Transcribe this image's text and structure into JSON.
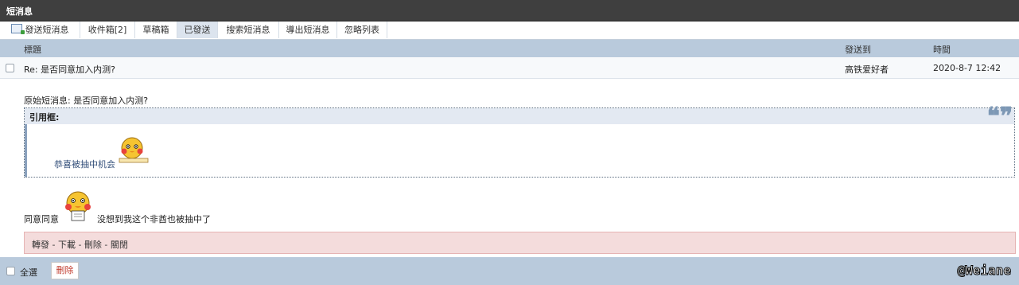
{
  "window": {
    "title": "短消息"
  },
  "tabs": [
    {
      "label": "發送短消息",
      "active": false
    },
    {
      "label": "收件箱[2]",
      "active": false
    },
    {
      "label": "草稿箱",
      "active": false
    },
    {
      "label": "已發送",
      "active": true
    },
    {
      "label": "搜索短消息",
      "active": false
    },
    {
      "label": "導出短消息",
      "active": false
    },
    {
      "label": "忽略列表",
      "active": false
    }
  ],
  "columns": {
    "title": "標題",
    "to": "發送到",
    "time": "時間"
  },
  "message": {
    "subject": "Re: 是否同意加入内测?",
    "to": "高铁爱好者",
    "time": "2020-8-7 12:42",
    "original_line": "原始短消息: 是否同意加入内测?",
    "quote_label": "引用框:",
    "quote_mark": "❝❞",
    "quote_text": "恭喜被抽中机会",
    "reply_part1": "同意同意",
    "reply_part2": "没想到我这个非酋也被抽中了"
  },
  "actions": {
    "text": "轉發 - 下載 - 刪除 - 關閉"
  },
  "footer": {
    "select_all": "全選",
    "delete": "刪除",
    "watermark": "@Weiane"
  },
  "colors": {
    "titlebar": "#3f3f3f",
    "header": "#b9cadc",
    "action_bg": "#f4dcdc",
    "accent_red": "#c0392b"
  }
}
